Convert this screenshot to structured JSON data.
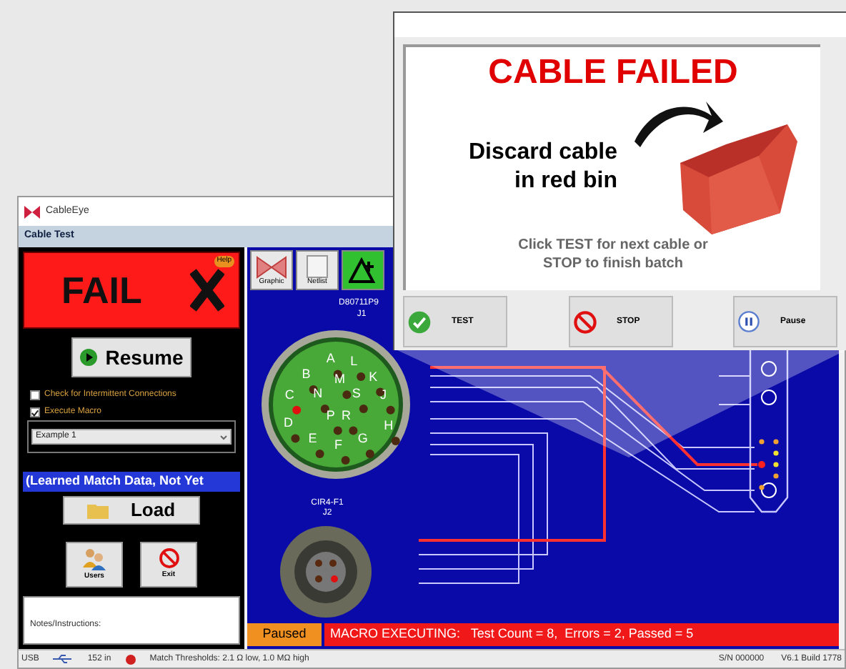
{
  "app": {
    "title": "CableEye",
    "section": "Cable Test"
  },
  "result": {
    "label": "FAIL",
    "help": "Help"
  },
  "resume_button": "Resume",
  "options": [
    {
      "label": "Check for Intermittent Connections",
      "checked": false
    },
    {
      "label": "Execute Macro",
      "checked": true
    }
  ],
  "macro_select": {
    "value": "Example 1"
  },
  "match_data": "(Learned Match Data, Not Yet",
  "load_button": "Load",
  "buttons": [
    {
      "label": "Users",
      "kind": "users"
    },
    {
      "label": "Exit",
      "kind": "exit"
    }
  ],
  "notes_label": "Notes/Instructions:",
  "toolbar": [
    {
      "label": "Graphic",
      "kind": "graphic"
    },
    {
      "label": "Netlist",
      "kind": "netlist"
    },
    {
      "kind": "chart"
    }
  ],
  "diagram": {
    "connectors": [
      {
        "name": "D80711P9",
        "ref": "J1",
        "pins": [
          {
            "label": "A",
            "faulty": false
          },
          {
            "label": "L",
            "faulty": false
          },
          {
            "label": "B",
            "faulty": false
          },
          {
            "label": "M",
            "faulty": false
          },
          {
            "label": "K",
            "faulty": false
          },
          {
            "label": "C",
            "faulty": true
          },
          {
            "label": "N",
            "faulty": false
          },
          {
            "label": "S",
            "faulty": false
          },
          {
            "label": "J",
            "faulty": false
          },
          {
            "label": "P",
            "faulty": false
          },
          {
            "label": "R",
            "faulty": false
          },
          {
            "label": "D",
            "faulty": false
          },
          {
            "label": "H",
            "faulty": false
          },
          {
            "label": "E",
            "faulty": false
          },
          {
            "label": "G",
            "faulty": false
          },
          {
            "label": "F",
            "faulty": false
          }
        ]
      },
      {
        "name": "CIR4-F1",
        "ref": "J2"
      }
    ]
  },
  "run_status": {
    "state": "Paused",
    "message": "MACRO EXECUTING:   Test Count = 8,  Errors = 2, Passed = 5"
  },
  "status_bar": {
    "left": [
      "USB",
      "152 in",
      "Match Thresholds: 2.1 Ω low, 1.0 MΩ high"
    ],
    "right": [
      "S/N 000000",
      "V6.1 Build 1778"
    ]
  },
  "dialog": {
    "heading": "CABLE FAILED",
    "instruction_lines": [
      "Discard cable",
      "in red bin"
    ],
    "prompt_lines": [
      "Click TEST for next cable or",
      "STOP to finish batch"
    ],
    "buttons": [
      {
        "label": "TEST",
        "kind": "test"
      },
      {
        "label": "STOP",
        "kind": "stop"
      },
      {
        "label": "Pause",
        "kind": "pause"
      }
    ]
  }
}
